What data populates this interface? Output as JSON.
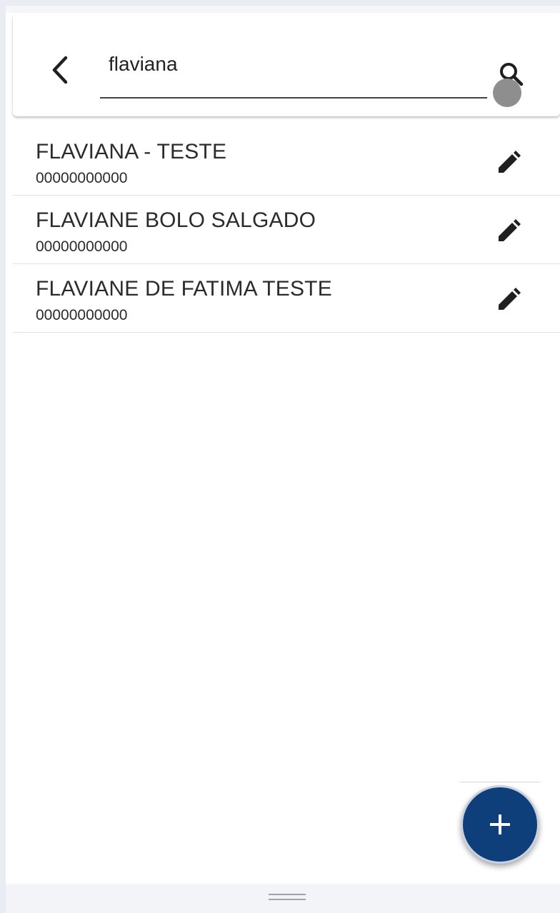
{
  "search": {
    "query": "flaviana",
    "back_icon": "chevron-left-icon",
    "search_icon": "search-icon"
  },
  "results": [
    {
      "name": "FLAVIANA - TESTE",
      "phone": "00000000000",
      "action_icon": "pencil-icon"
    },
    {
      "name": "FLAVIANE BOLO SALGADO",
      "phone": "00000000000",
      "action_icon": "pencil-icon"
    },
    {
      "name": "FLAVIANE DE FATIMA TESTE",
      "phone": "00000000000",
      "action_icon": "pencil-icon"
    }
  ],
  "fab": {
    "icon": "plus-icon"
  },
  "colors": {
    "accent": "#0f3f7b",
    "page_bg": "#e9ecf3",
    "text": "#2b2b2b"
  }
}
